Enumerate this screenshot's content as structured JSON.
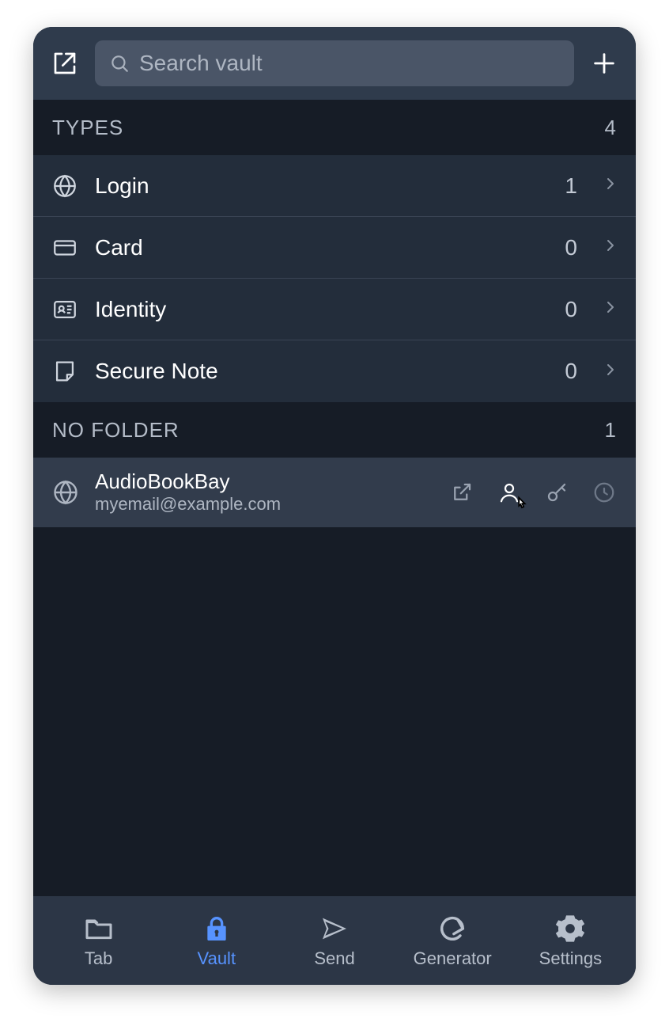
{
  "header": {
    "search_placeholder": "Search vault"
  },
  "sections": {
    "types": {
      "title": "TYPES",
      "count": "4",
      "items": [
        {
          "label": "Login",
          "count": "1"
        },
        {
          "label": "Card",
          "count": "0"
        },
        {
          "label": "Identity",
          "count": "0"
        },
        {
          "label": "Secure Note",
          "count": "0"
        }
      ]
    },
    "nofolder": {
      "title": "NO FOLDER",
      "count": "1",
      "items": [
        {
          "title": "AudioBookBay",
          "subtitle": "myemail@example.com"
        }
      ]
    }
  },
  "nav": {
    "tab": "Tab",
    "vault": "Vault",
    "send": "Send",
    "generator": "Generator",
    "settings": "Settings"
  }
}
